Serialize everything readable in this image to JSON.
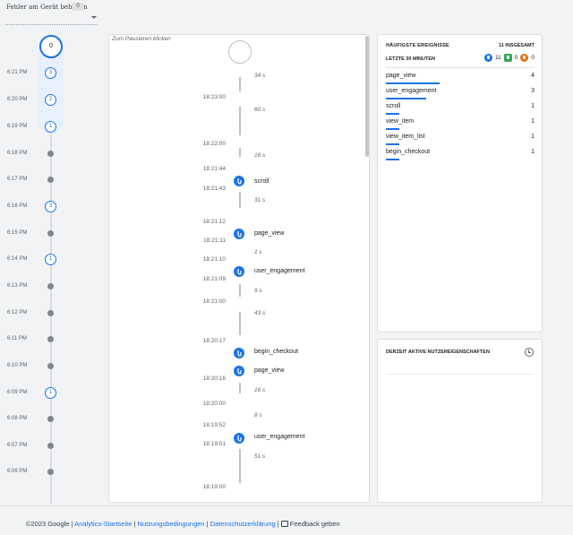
{
  "header": {
    "debug_label": "Fehler am Gerät beheben",
    "debug_count": "0"
  },
  "minutes": {
    "top_count": "0",
    "rows": [
      {
        "label": "6:21 PM",
        "type": "circle",
        "count": "3"
      },
      {
        "label": "6:20 PM",
        "type": "circle",
        "count": "2"
      },
      {
        "label": "6:19 PM",
        "type": "circle",
        "count": "1"
      },
      {
        "label": "6:18 PM",
        "type": "dot",
        "count": ""
      },
      {
        "label": "6:17 PM",
        "type": "dot",
        "count": ""
      },
      {
        "label": "6:16 PM",
        "type": "circle",
        "count": "3"
      },
      {
        "label": "6:15 PM",
        "type": "dot",
        "count": ""
      },
      {
        "label": "6:14 PM",
        "type": "circle",
        "count": "1"
      },
      {
        "label": "6:13 PM",
        "type": "dot",
        "count": ""
      },
      {
        "label": "6:12 PM",
        "type": "dot",
        "count": ""
      },
      {
        "label": "6:11 PM",
        "type": "dot",
        "count": ""
      },
      {
        "label": "6:10 PM",
        "type": "dot",
        "count": ""
      },
      {
        "label": "6:09 PM",
        "type": "circle",
        "count": "1"
      },
      {
        "label": "6:08 PM",
        "type": "dot",
        "count": ""
      },
      {
        "label": "6:07 PM",
        "type": "dot",
        "count": ""
      },
      {
        "label": "6:06 PM",
        "type": "dot",
        "count": ""
      }
    ]
  },
  "stream": {
    "pause_hint": "Zum Pausieren klicken",
    "times": [
      "18:23:00",
      "18:22:00",
      "18:21:44",
      "18:21:43",
      "18:21:12",
      "18:21:11",
      "18:21:10",
      "18:21:09",
      "18:21:00",
      "18:20:17",
      "18:20:16",
      "18:20:00",
      "18:19:52",
      "18:19:51",
      "18:19:00"
    ],
    "durations": [
      "34 s",
      "60 s",
      "16 s",
      "31 s",
      "1 s",
      "9 s",
      "43 s",
      "16 s",
      "8 s",
      "51 s"
    ],
    "events": [
      "scroll",
      "page_view",
      "user_engagement",
      "begin_checkout",
      "page_view",
      "user_engagement"
    ]
  },
  "top_events": {
    "title": "HÄUFIGSTE EREIGNISSE",
    "total": "11 INSGESAMT",
    "range": "LETZTE 30 MINUTEN",
    "badge_blue": "11",
    "badge_green": "0",
    "badge_orange": "0",
    "rows": [
      {
        "name": "page_view",
        "count": "4",
        "share": 0.36
      },
      {
        "name": "user_engagement",
        "count": "3",
        "share": 0.27
      },
      {
        "name": "scroll",
        "count": "1",
        "share": 0.09
      },
      {
        "name": "view_item",
        "count": "1",
        "share": 0.09
      },
      {
        "name": "view_item_list",
        "count": "1",
        "share": 0.09
      },
      {
        "name": "begin_checkout",
        "count": "1",
        "share": 0.09
      }
    ]
  },
  "user_props": {
    "title": "DERZEIT AKTIVE NUTZEREIGENSCHAFTEN"
  },
  "footer": {
    "copyright": "©2023 Google",
    "link_home": "Analytics-Startseite",
    "link_terms": "Nutzungsbedingungen",
    "link_privacy": "Datenschutzerklärung",
    "feedback": "Feedback geben"
  }
}
